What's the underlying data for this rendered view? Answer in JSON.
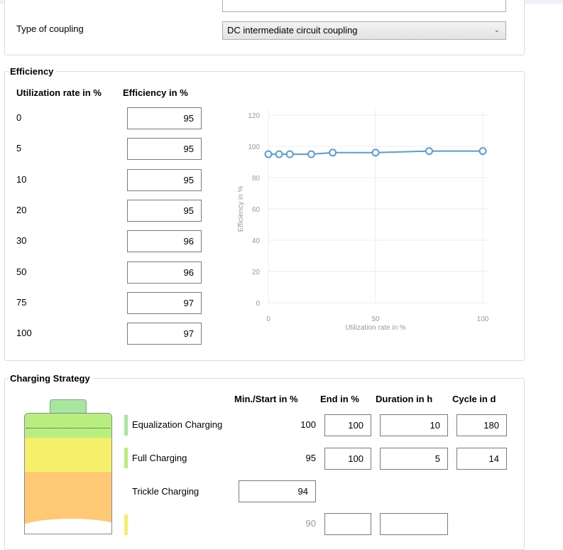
{
  "coupling": {
    "label": "Type of coupling",
    "value": "DC intermediate circuit coupling",
    "chevron_icon": "chevron-down-icon"
  },
  "efficiency": {
    "title": "Efficiency",
    "col_utilization": "Utilization rate in %",
    "col_efficiency": "Efficiency in %",
    "rows": [
      {
        "utilization": "0",
        "efficiency": "95"
      },
      {
        "utilization": "5",
        "efficiency": "95"
      },
      {
        "utilization": "10",
        "efficiency": "95"
      },
      {
        "utilization": "20",
        "efficiency": "95"
      },
      {
        "utilization": "30",
        "efficiency": "96"
      },
      {
        "utilization": "50",
        "efficiency": "96"
      },
      {
        "utilization": "75",
        "efficiency": "97"
      },
      {
        "utilization": "100",
        "efficiency": "97"
      }
    ]
  },
  "chart_data": {
    "type": "line",
    "x": [
      0,
      5,
      10,
      20,
      30,
      50,
      75,
      100
    ],
    "y": [
      95,
      95,
      95,
      95,
      96,
      96,
      97,
      97
    ],
    "xlabel": "Utilization rate in %",
    "ylabel": "Efficiency in %",
    "xlim": [
      0,
      100
    ],
    "ylim": [
      0,
      120
    ],
    "xticks": [
      0,
      50,
      100
    ],
    "yticks": [
      0,
      20,
      40,
      60,
      80,
      100,
      120
    ],
    "grid": true,
    "line_color": "#5b9bd5"
  },
  "charging": {
    "title": "Charging Strategy",
    "col_min_start": "Min./Start in %",
    "col_end": "End in %",
    "col_duration": "Duration in h",
    "col_cycle": "Cycle in d",
    "equalization": {
      "label": "Equalization Charging",
      "min_start": "100",
      "end": "100",
      "duration": "10",
      "cycle": "180",
      "color": "#a8e6a0"
    },
    "full": {
      "label": "Full Charging",
      "min_start": "95",
      "end": "100",
      "duration": "5",
      "cycle": "14",
      "color": "#b8ee80"
    },
    "trickle": {
      "label": "Trickle Charging",
      "value": "94"
    },
    "fourth_row_min_start": "90",
    "fourth_row_color": "#f5ef6a",
    "battery_colors": {
      "top": "#a8e6a0",
      "upper": "#f5ef6a",
      "lower": "#ffc875"
    }
  }
}
